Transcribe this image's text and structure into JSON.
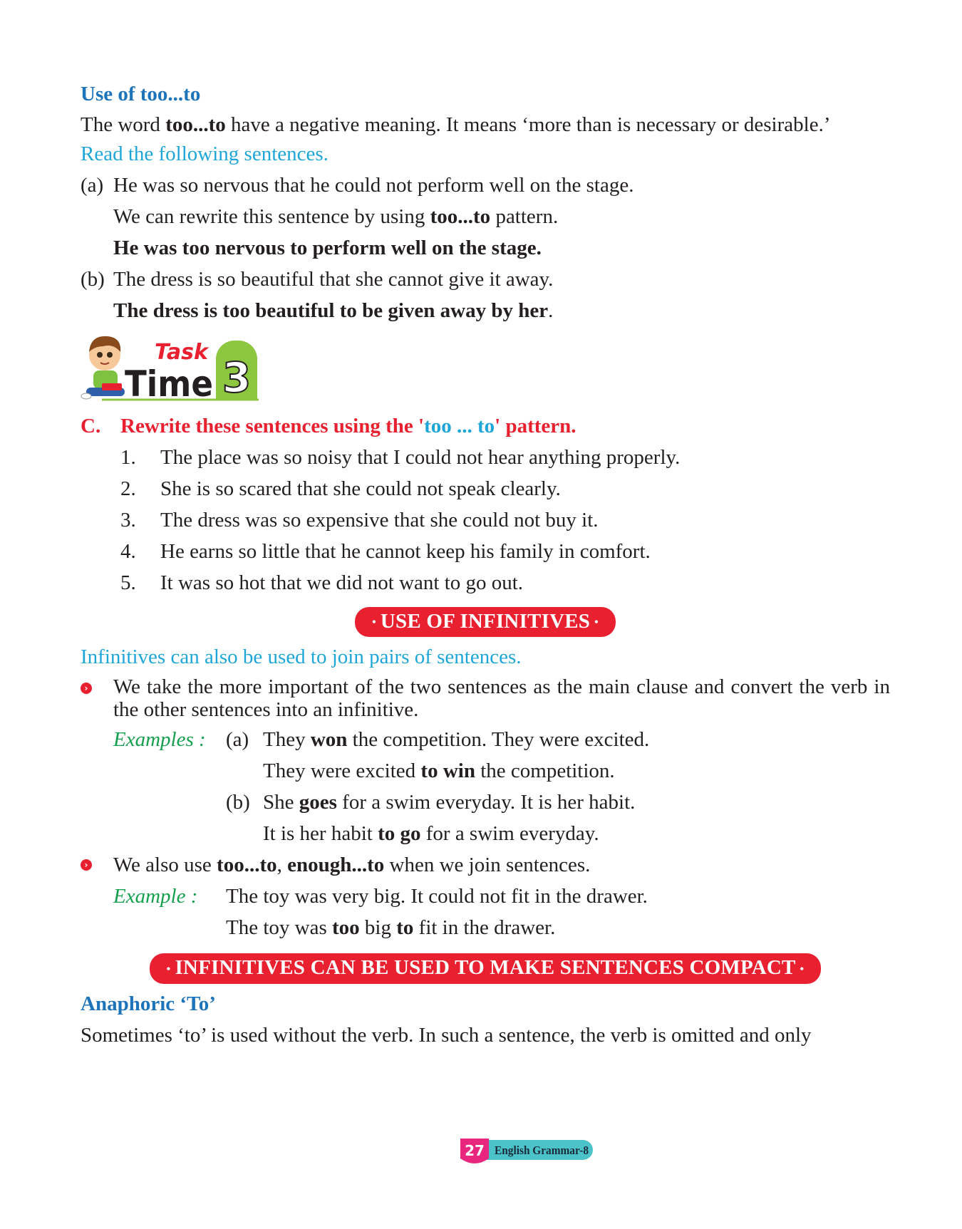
{
  "section1": {
    "heading": "Use of too...to",
    "intro_a": "The word ",
    "intro_bold": "too...to",
    "intro_b": " have a negative meaning. It means ‘more than is necessary or desirable.’",
    "read_label": "Read the following sentences.",
    "a_label": "(a)",
    "a_sentence": "He was so nervous that he could not perform well on the stage.",
    "a_rewrite_a": "We can rewrite this sentence by using ",
    "a_rewrite_bold": "too...to",
    "a_rewrite_b": " pattern.",
    "a_result": "He was too nervous to perform well on the stage.",
    "b_label": "(b)",
    "b_sentence": "The dress is so beautiful that she cannot give it away.",
    "b_result": "The dress is too beautiful to be given away by her",
    "b_result_end": "."
  },
  "task_logo": {
    "word1": "Task",
    "word2": "Time",
    "number": "3"
  },
  "exercise": {
    "letter": "C.",
    "instruction_a": "Rewrite these sentences using the '",
    "instruction_cyan": "too ... to",
    "instruction_b": "' pattern.",
    "items": [
      {
        "num": "1.",
        "text": "The place was so noisy that I could not hear anything properly."
      },
      {
        "num": "2.",
        "text": "She is so scared that she could not speak clearly."
      },
      {
        "num": "3.",
        "text": "The dress was so expensive that she could not buy it."
      },
      {
        "num": "4.",
        "text": "He earns so little that he cannot keep his family in comfort."
      },
      {
        "num": "5.",
        "text": "It was so hot that we did not want to go out."
      }
    ]
  },
  "infinitives": {
    "banner": "USE OF INFINITIVES",
    "subtitle": "Infinitives can also be used to join pairs of sentences.",
    "bullet1": "We take the more important of the two sentences as the main clause and convert the verb in the other sentences into an infinitive.",
    "examples_label": "Examples :",
    "ex_a_label": "(a)",
    "ex_a1_a": "They ",
    "ex_a1_bold": "won",
    "ex_a1_b": " the competition. They were excited.",
    "ex_a2_a": "They were excited ",
    "ex_a2_bold": "to win",
    "ex_a2_b": " the competition.",
    "ex_b_label": "(b)",
    "ex_b1_a": "She ",
    "ex_b1_bold": "goes",
    "ex_b1_b": " for a swim everyday. It is her habit.",
    "ex_b2_a": "It is her habit ",
    "ex_b2_bold": "to go",
    "ex_b2_b": " for a swim everyday.",
    "bullet2_a": "We also use ",
    "bullet2_bold1": "too...to",
    "bullet2_sep": ", ",
    "bullet2_bold2": "enough...to",
    "bullet2_b": " when we join sentences.",
    "example_label": "Example :",
    "ex_c1": "The toy was very big. It could not fit in the drawer.",
    "ex_c2_a": "The toy was ",
    "ex_c2_bold1": "too",
    "ex_c2_mid": " big ",
    "ex_c2_bold2": "to",
    "ex_c2_b": " fit in the drawer."
  },
  "compact": {
    "banner": "INFINITIVES CAN BE USED TO MAKE SENTENCES COMPACT",
    "heading": "Anaphoric ‘To’",
    "text": "Sometimes ‘to’ is used without the verb. In such a sentence, the verb is omitted and only"
  },
  "footer": {
    "page_number": "27",
    "book_title": "English Grammar-8"
  },
  "colors": {
    "heading_blue": "#1e74bb",
    "cyan": "#1fa6d8",
    "red": "#e8202f",
    "green": "#14a04e",
    "footer_teal": "#4cc3c9",
    "footer_pink": "#e8267d"
  }
}
